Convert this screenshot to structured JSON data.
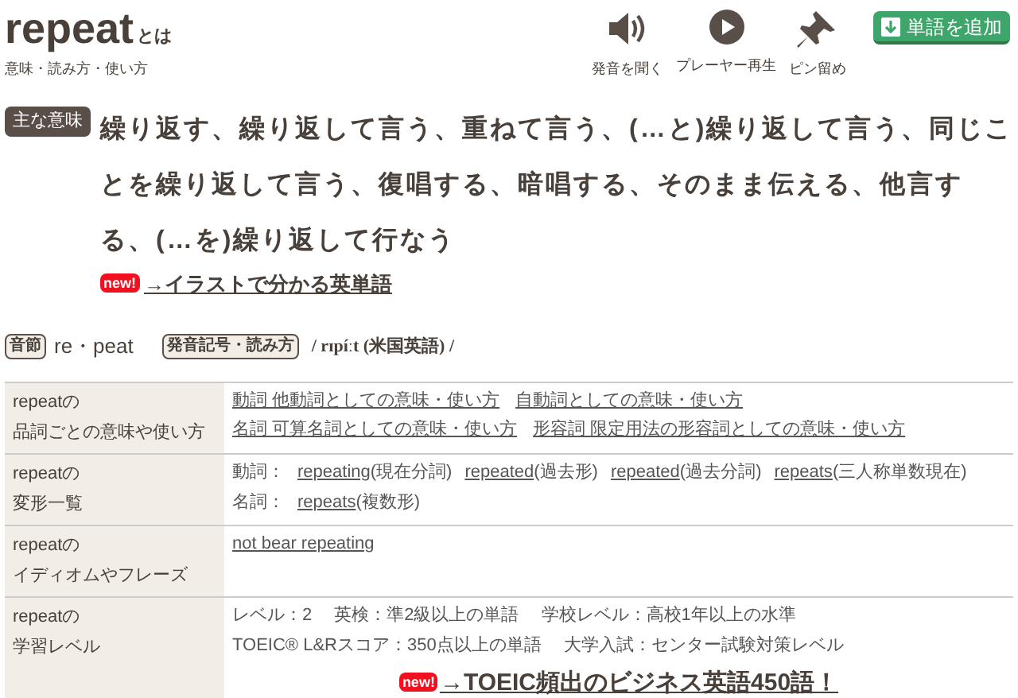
{
  "header": {
    "word": "repeat",
    "suffix": "とは",
    "subtitle": "意味・読み方・使い方"
  },
  "actions": [
    {
      "kind": "speaker",
      "label": "発音を聞く"
    },
    {
      "kind": "play",
      "label": "プレーヤー再生"
    },
    {
      "kind": "pin",
      "label": "ピン留め"
    }
  ],
  "add_button": "単語を追加",
  "main_meaning": {
    "tag": "主な意味",
    "text": "繰り返す、繰り返して言う、重ねて言う、(…と)繰り返して言う、同じことを繰り返して言う、復唱する、暗唱する、そのまま伝える、他言する、(…を)繰り返して行なう",
    "badge": "new!",
    "link": "→イラストで分かる英単語"
  },
  "pronunciation": {
    "syllable_tag": "音節",
    "syllables": "re・peat",
    "phonetic_tag": "発音記号・読み方",
    "phonetic": "/ rɪpíːt (米国英語) /"
  },
  "table": {
    "rows": [
      {
        "kind": "links",
        "label_word": "repeatの",
        "label": "品詞ごとの意味や使い方",
        "links": [
          "動詞 他動詞としての意味・使い方",
          "自動詞としての意味・使い方",
          "名詞 可算名詞としての意味・使い方",
          "形容詞 限定用法の形容詞としての意味・使い方"
        ]
      },
      {
        "kind": "forms",
        "label_word": "repeatの",
        "label": "変形一覧",
        "lines": [
          {
            "pos": "動詞：",
            "forms": [
              {
                "word": "repeating",
                "note": "(現在分詞)"
              },
              {
                "word": "repeated",
                "note": "(過去形)"
              },
              {
                "word": "repeated",
                "note": "(過去分詞)"
              },
              {
                "word": "repeats",
                "note": "(三人称単数現在)"
              }
            ]
          },
          {
            "pos": "名詞：",
            "forms": [
              {
                "word": "repeats",
                "note": "(複数形)"
              }
            ]
          }
        ]
      },
      {
        "kind": "links",
        "label_word": "repeatの",
        "label": "イディオムやフレーズ",
        "links": [
          "not bear repeating"
        ]
      },
      {
        "kind": "level",
        "label_word": "repeatの",
        "label": "学習レベル",
        "items": [
          "レベル：2",
          "英検：準2級以上の単語",
          "学校レベル：高校1年以上の水準",
          "TOEIC® L&Rスコア：350点以上の単語",
          "大学入試：センター試験対策レベル"
        ],
        "badge": "new!",
        "link": "→TOEIC頻出のビジネス英語450語！"
      }
    ]
  }
}
